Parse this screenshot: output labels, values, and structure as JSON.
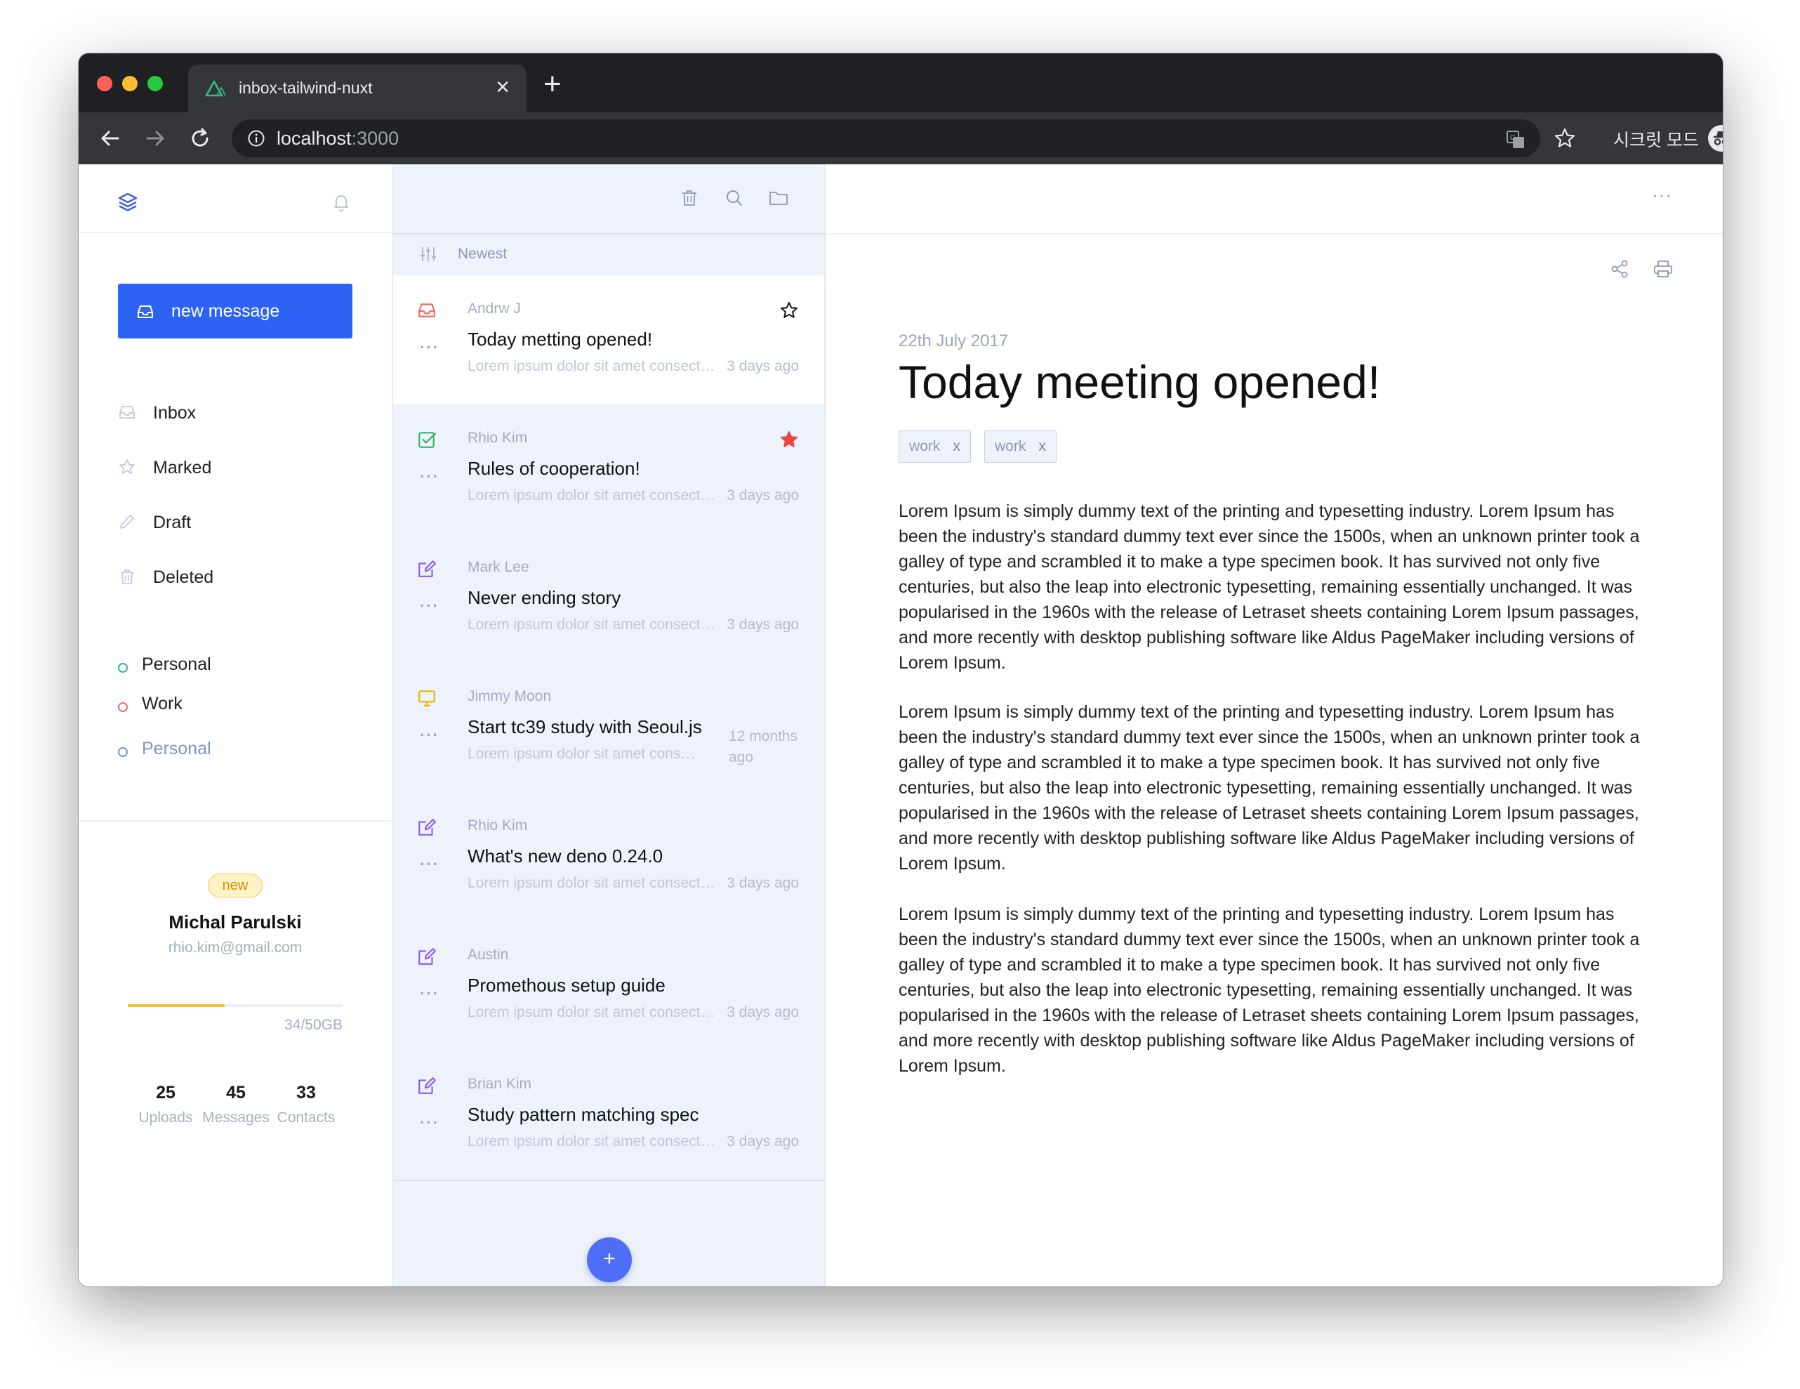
{
  "browser": {
    "tab_title": "inbox-tailwind-nuxt",
    "url_host": "localhost",
    "url_port": ":3000",
    "incognito_label": "시크릿 모드",
    "icons": [
      "back-arrow-icon",
      "forward-arrow-icon",
      "reload-icon",
      "info-icon",
      "translate-icon",
      "star-icon",
      "incognito-icon",
      "kebab-menu-icon"
    ]
  },
  "sidebar": {
    "new_message_label": "new message",
    "nav": [
      {
        "label": "Inbox",
        "icon": "inbox-icon"
      },
      {
        "label": "Marked",
        "icon": "star-icon"
      },
      {
        "label": "Draft",
        "icon": "pencil-icon"
      },
      {
        "label": "Deleted",
        "icon": "trash-icon"
      }
    ],
    "labels": [
      {
        "label": "Personal",
        "color": "#34b3a0"
      },
      {
        "label": "Work",
        "color": "#f06a6a"
      },
      {
        "label": "Personal",
        "color": "#7f93c9"
      }
    ],
    "profile": {
      "badge": "new",
      "name": "Michal Parulski",
      "email": "rhio.kim@gmail.com",
      "storage_text": "34/50GB",
      "storage_fraction": 0.45
    },
    "stats": [
      {
        "value": "25",
        "label": "Uploads"
      },
      {
        "value": "45",
        "label": "Messages"
      },
      {
        "value": "33",
        "label": "Contacts"
      }
    ]
  },
  "list": {
    "sort_label": "Newest",
    "mails": [
      {
        "from": "Andrw J",
        "subject": "Today metting opened!",
        "preview": "Lorem ipsum dolor sit amet consectetur",
        "time": "3 days ago",
        "icon": "inbox-icon",
        "icon_color": "#f06a6a",
        "starred": false,
        "show_star": true
      },
      {
        "from": "Rhio Kim",
        "subject": "Rules of cooperation!",
        "preview": "Lorem ipsum dolor sit amet consectetur",
        "time": "3 days ago",
        "icon": "check-square-icon",
        "icon_color": "#39b36b",
        "starred": true,
        "show_star": true
      },
      {
        "from": "Mark Lee",
        "subject": "Never ending story",
        "preview": "Lorem ipsum dolor sit amet consectetur",
        "time": "3 days ago",
        "icon": "edit-icon",
        "icon_color": "#8b5cf6",
        "starred": false,
        "show_star": false
      },
      {
        "from": "Jimmy Moon",
        "subject": "Start tc39 study with Seoul.js",
        "preview": "Lorem ipsum dolor sit amet consectetur",
        "time": "12 months ago",
        "icon": "monitor-icon",
        "icon_color": "#e6b800",
        "starred": false,
        "show_star": false
      },
      {
        "from": "Rhio Kim",
        "subject": "What's new deno 0.24.0",
        "preview": "Lorem ipsum dolor sit amet consectetur",
        "time": "3 days ago",
        "icon": "edit-icon",
        "icon_color": "#8b5cf6",
        "starred": false,
        "show_star": false
      },
      {
        "from": "Austin",
        "subject": "Promethous setup guide",
        "preview": "Lorem ipsum dolor sit amet consectetur",
        "time": "3 days ago",
        "icon": "edit-icon",
        "icon_color": "#8b5cf6",
        "starred": false,
        "show_star": false
      },
      {
        "from": "Brian Kim",
        "subject": "Study pattern matching spec",
        "preview": "Lorem ipsum dolor sit amet consectetur",
        "time": "3 days ago",
        "icon": "edit-icon",
        "icon_color": "#8b5cf6",
        "starred": false,
        "show_star": false
      }
    ],
    "fab_label": "+"
  },
  "reader": {
    "more_label": "···",
    "date": "22th July 2017",
    "title": "Today meeting opened!",
    "tags": [
      {
        "label": "work",
        "remove": "x"
      },
      {
        "label": "work",
        "remove": "x"
      }
    ],
    "paragraphs": [
      "Lorem Ipsum is simply dummy text of the printing and typesetting industry. Lorem Ipsum has been the industry's standard dummy text ever since the 1500s, when an unknown printer took a galley of type and scrambled it to make a type specimen book. It has survived not only five centuries, but also the leap into electronic typesetting, remaining essentially unchanged. It was popularised in the 1960s with the release of Letraset sheets containing Lorem Ipsum passages, and more recently with desktop publishing software like Aldus PageMaker including versions of Lorem Ipsum.",
      "Lorem Ipsum is simply dummy text of the printing and typesetting industry. Lorem Ipsum has been the industry's standard dummy text ever since the 1500s, when an unknown printer took a galley of type and scrambled it to make a type specimen book. It has survived not only five centuries, but also the leap into electronic typesetting, remaining essentially unchanged. It was popularised in the 1960s with the release of Letraset sheets containing Lorem Ipsum passages, and more recently with desktop publishing software like Aldus PageMaker including versions of Lorem Ipsum.",
      "Lorem Ipsum is simply dummy text of the printing and typesetting industry. Lorem Ipsum has been the industry's standard dummy text ever since the 1500s, when an unknown printer took a galley of type and scrambled it to make a type specimen book. It has survived not only five centuries, but also the leap into electronic typesetting, remaining essentially unchanged. It was popularised in the 1960s with the release of Letraset sheets containing Lorem Ipsum passages, and more recently with desktop publishing software like Aldus PageMaker including versions of Lorem Ipsum."
    ]
  },
  "colors": {
    "accent": "#2d63f5",
    "fab": "#4f6ef7",
    "star_filled": "#ef4444",
    "storage_bar": "#f3c33a"
  }
}
